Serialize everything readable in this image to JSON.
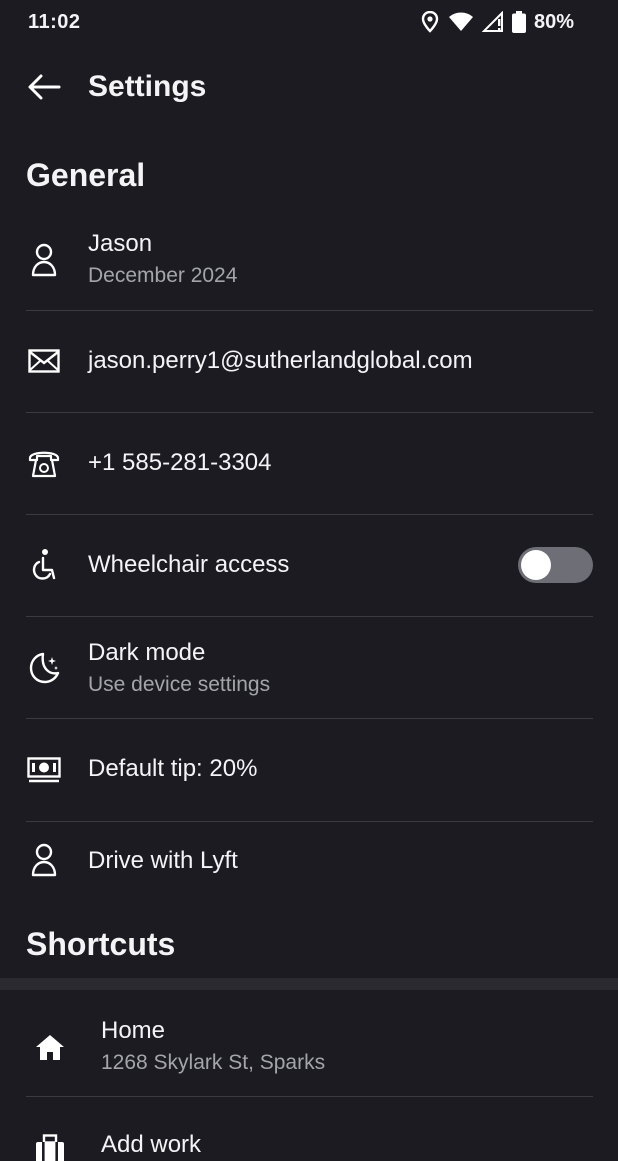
{
  "status": {
    "time": "11:02",
    "battery": "80%"
  },
  "header": {
    "title": "Settings"
  },
  "general": {
    "title": "General",
    "profile": {
      "name": "Jason",
      "since": "December 2024"
    },
    "email": "jason.perry1@sutherlandglobal.com",
    "phone": "+1 585-281-3304",
    "wheelchair": {
      "label": "Wheelchair access",
      "enabled": false
    },
    "dark_mode": {
      "label": "Dark mode",
      "value": "Use device settings"
    },
    "tip": "Default tip: 20%",
    "drive": "Drive with Lyft"
  },
  "shortcuts": {
    "title": "Shortcuts",
    "home": {
      "label": "Home",
      "address": "1268 Skylark St, Sparks"
    },
    "work": {
      "label": "Add work"
    }
  },
  "colors": {
    "background": "#1b1b21",
    "divider": "#3b3b44",
    "secondary_text": "#a4a4ad",
    "toggle_off": "#6e6e76"
  },
  "icons": [
    "location-icon",
    "wifi-icon",
    "signal-icon",
    "battery-icon",
    "back-arrow-icon",
    "person-icon",
    "mail-icon",
    "phone-icon",
    "wheelchair-icon",
    "moon-icon",
    "cash-icon",
    "home-icon",
    "briefcase-icon"
  ]
}
